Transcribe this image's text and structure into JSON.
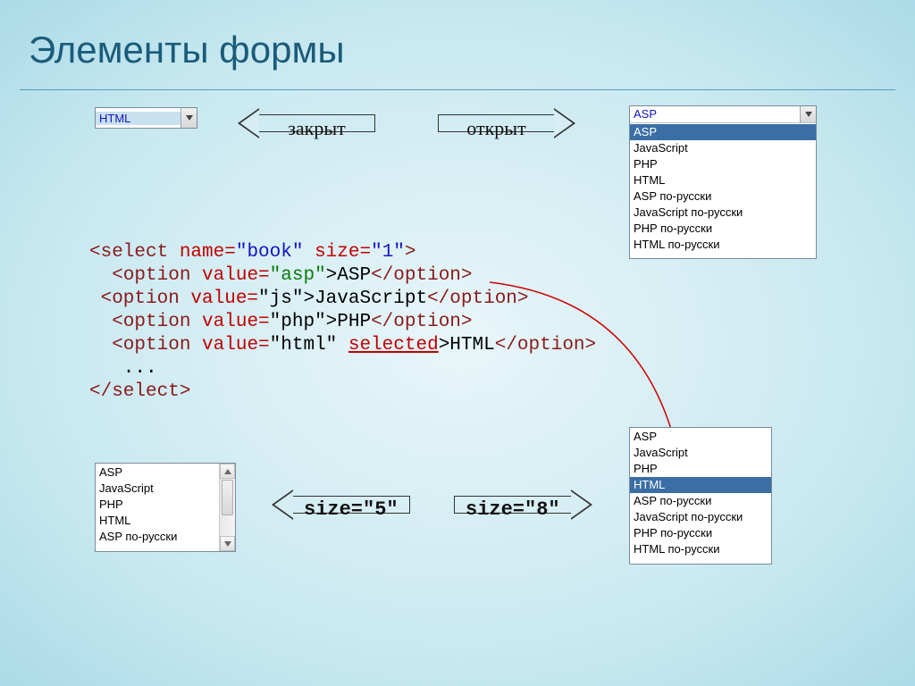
{
  "title": "Элементы формы",
  "closed_select": {
    "value": "HTML"
  },
  "arrow_closed_label": "закрыт",
  "arrow_open_label": "открыт",
  "open_select": {
    "header": "ASP",
    "selected_index": 0,
    "options": [
      "ASP",
      "JavaScript",
      "PHP",
      "HTML",
      "ASP по-русски",
      "JavaScript по-русски",
      "PHP по-русски",
      "HTML по-русски"
    ]
  },
  "code": {
    "l1_a": "<select ",
    "l1_b": "name=",
    "l1_c": "\"book\"",
    "l1_d": " size=",
    "l1_e": "\"1\"",
    "l1_f": ">",
    "l2_a": "  <option ",
    "l2_b": "value=",
    "l2_c": "\"asp\"",
    "l2_d": ">ASP",
    "l2_e": "</option>",
    "l3_a": " <option ",
    "l3_b": "value=",
    "l3_c": "\"js\">JavaScript",
    "l3_d": "</option>",
    "l4_a": "  <option ",
    "l4_b": "value=",
    "l4_c": "\"php\">PHP",
    "l4_d": "</option>",
    "l5_a": "  <option ",
    "l5_b": "value=",
    "l5_c": "\"html\" ",
    "l5_d": "selected",
    "l5_e": ">HTML",
    "l5_f": "</option>",
    "l6": "   ...",
    "l7": "</select>"
  },
  "arrow_size5_label": "size=\"5\"",
  "arrow_size8_label": "size=\"8\"",
  "size5": {
    "options": [
      "ASP",
      "JavaScript",
      "PHP",
      "HTML",
      "ASP по-русски"
    ]
  },
  "size8": {
    "selected_index": 3,
    "options": [
      "ASP",
      "JavaScript",
      "PHP",
      "HTML",
      "ASP по-русски",
      "JavaScript по-русски",
      "PHP по-русски",
      "HTML по-русски"
    ]
  }
}
